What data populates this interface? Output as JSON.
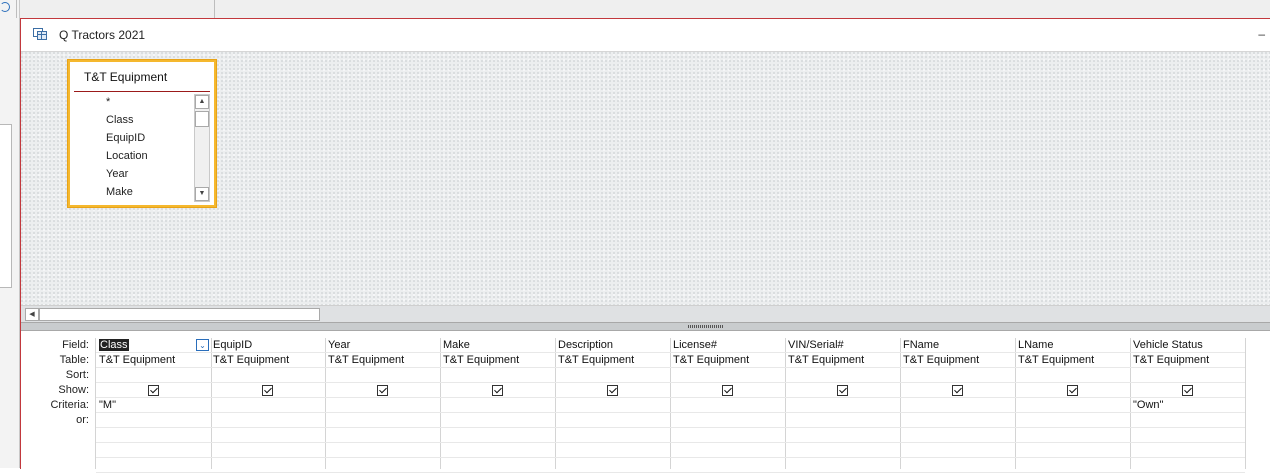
{
  "window": {
    "title": "Q Tractors 2021",
    "title_icon": "query-icon",
    "minimize_label": "–"
  },
  "table_box": {
    "title": "T&T Equipment",
    "fields": [
      "*",
      "Class",
      "EquipID",
      "Location",
      "Year",
      "Make"
    ]
  },
  "grid": {
    "row_labels": {
      "field": "Field:",
      "table": "Table:",
      "sort": "Sort:",
      "show": "Show:",
      "criteria": "Criteria:",
      "or": "or:"
    },
    "columns": [
      {
        "field": "Class",
        "table": "T&T Equipment",
        "show": true,
        "criteria": "\"M\"",
        "or": ""
      },
      {
        "field": "EquipID",
        "table": "T&T Equipment",
        "show": true,
        "criteria": "",
        "or": ""
      },
      {
        "field": "Year",
        "table": "T&T Equipment",
        "show": true,
        "criteria": "",
        "or": ""
      },
      {
        "field": "Make",
        "table": "T&T Equipment",
        "show": true,
        "criteria": "",
        "or": ""
      },
      {
        "field": "Description",
        "table": "T&T Equipment",
        "show": true,
        "criteria": "",
        "or": ""
      },
      {
        "field": "License#",
        "table": "T&T Equipment",
        "show": true,
        "criteria": "",
        "or": ""
      },
      {
        "field": "VIN/Serial#",
        "table": "T&T Equipment",
        "show": true,
        "criteria": "",
        "or": ""
      },
      {
        "field": "FName",
        "table": "T&T Equipment",
        "show": true,
        "criteria": "",
        "or": ""
      },
      {
        "field": "LName",
        "table": "T&T Equipment",
        "show": true,
        "criteria": "",
        "or": ""
      },
      {
        "field": "Vehicle Status",
        "table": "T&T Equipment",
        "show": true,
        "criteria": "\"Own\"",
        "or": ""
      }
    ]
  },
  "colors": {
    "window_border": "#c2383d",
    "table_highlight": "#f5b82e",
    "selection": "#222222"
  }
}
